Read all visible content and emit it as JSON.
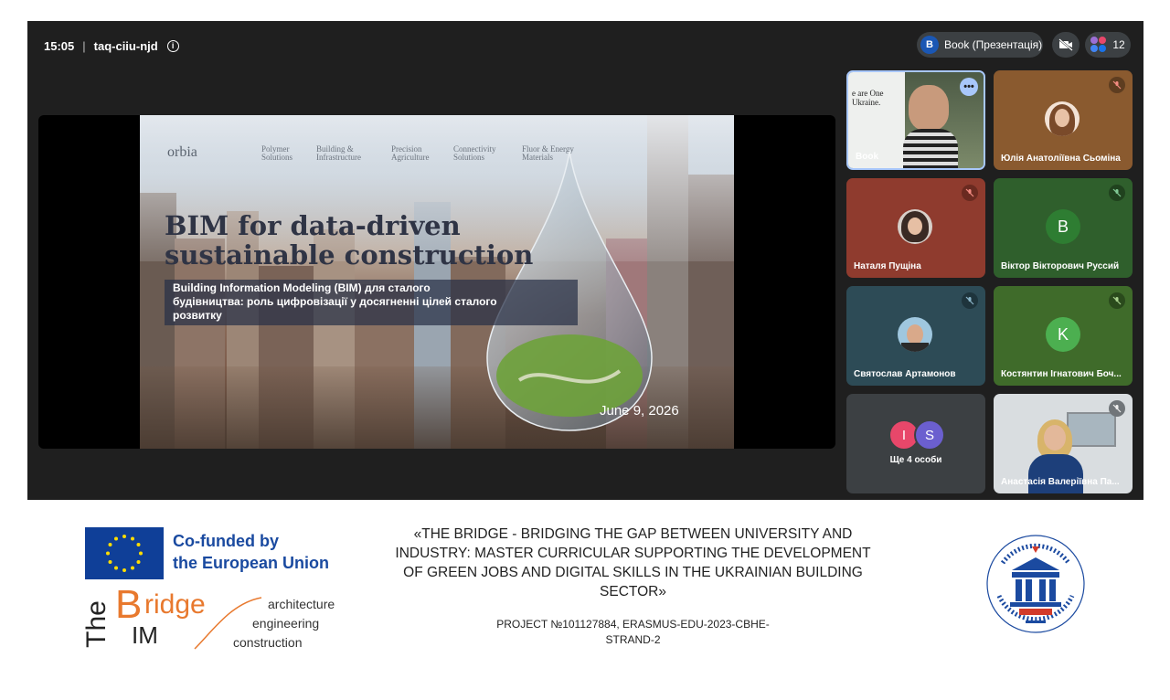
{
  "meeting": {
    "time": "15:05",
    "code": "taq-ciiu-njd",
    "presenter_initial": "B",
    "presenter_label": "Book (Презентація)",
    "participants_count": "12"
  },
  "slide": {
    "logo": "orbia",
    "nav": [
      "Polymer\nSolutions",
      "Building &\nInfrastructure",
      "Precision\nAgriculture",
      "Connectivity\nSolutions",
      "Fluor & Energy\nMaterials"
    ],
    "title": "BIM for data-driven sustainable construction",
    "subtitle": "Building Information Modeling (BIM) для сталого будівництва: роль цифровізації у досягненні цілей сталого розвитку",
    "date": "June 9, 2026"
  },
  "tiles": [
    {
      "name": "Book",
      "type": "video",
      "bg": "#6b7a66"
    },
    {
      "name": "Юлія Анатоліївна Сьоміна",
      "type": "photo",
      "bg": "#8a5a2f"
    },
    {
      "name": "Наталя Пущіна",
      "type": "photo",
      "bg": "#8f3b2e"
    },
    {
      "name": "Віктор Вікторович Руссий",
      "type": "letter",
      "initial": "B",
      "bg": "#2f5f2c",
      "avatar": "#2e7d32"
    },
    {
      "name": "Святослав Артамонов",
      "type": "photo",
      "bg": "#2d4b56"
    },
    {
      "name": "Костянтин Ігнатович Боч...",
      "type": "letter",
      "initial": "K",
      "bg": "#3f6b2a",
      "avatar": "#4caf50"
    },
    {
      "name": "Ще 4 особи",
      "type": "more",
      "bg": "#3c4043",
      "initials": [
        "I",
        "S"
      ]
    },
    {
      "name": "Анастасія Валеріївна Па...",
      "type": "video2",
      "bg": "#d9dde0"
    }
  ],
  "footer": {
    "eu_line1": "Co-funded by",
    "eu_line2": "the European Union",
    "bridge_the": "The",
    "bridge_b": "B",
    "bridge_ridge": "ridge",
    "bridge_im": "IM",
    "bridge_words": [
      "architecture",
      "engineering",
      "construction"
    ],
    "project_title": "«THE BRIDGE - BRIDGING THE GAP BETWEEN UNIVERSITY AND INDUSTRY: MASTER CURRICULAR SUPPORTING THE DEVELOPMENT OF GREEN JOBS AND DIGITAL SKILLS IN THE UKRAINIAN BUILDING SECTOR»",
    "project_number": "PROJECT №101127884, ERASMUS-EDU-2023-CBHE-STRAND-2"
  },
  "colors": {
    "meet_bg": "#1f1f1f",
    "eu_blue": "#0f3f98",
    "bim_orange": "#e8792e"
  }
}
